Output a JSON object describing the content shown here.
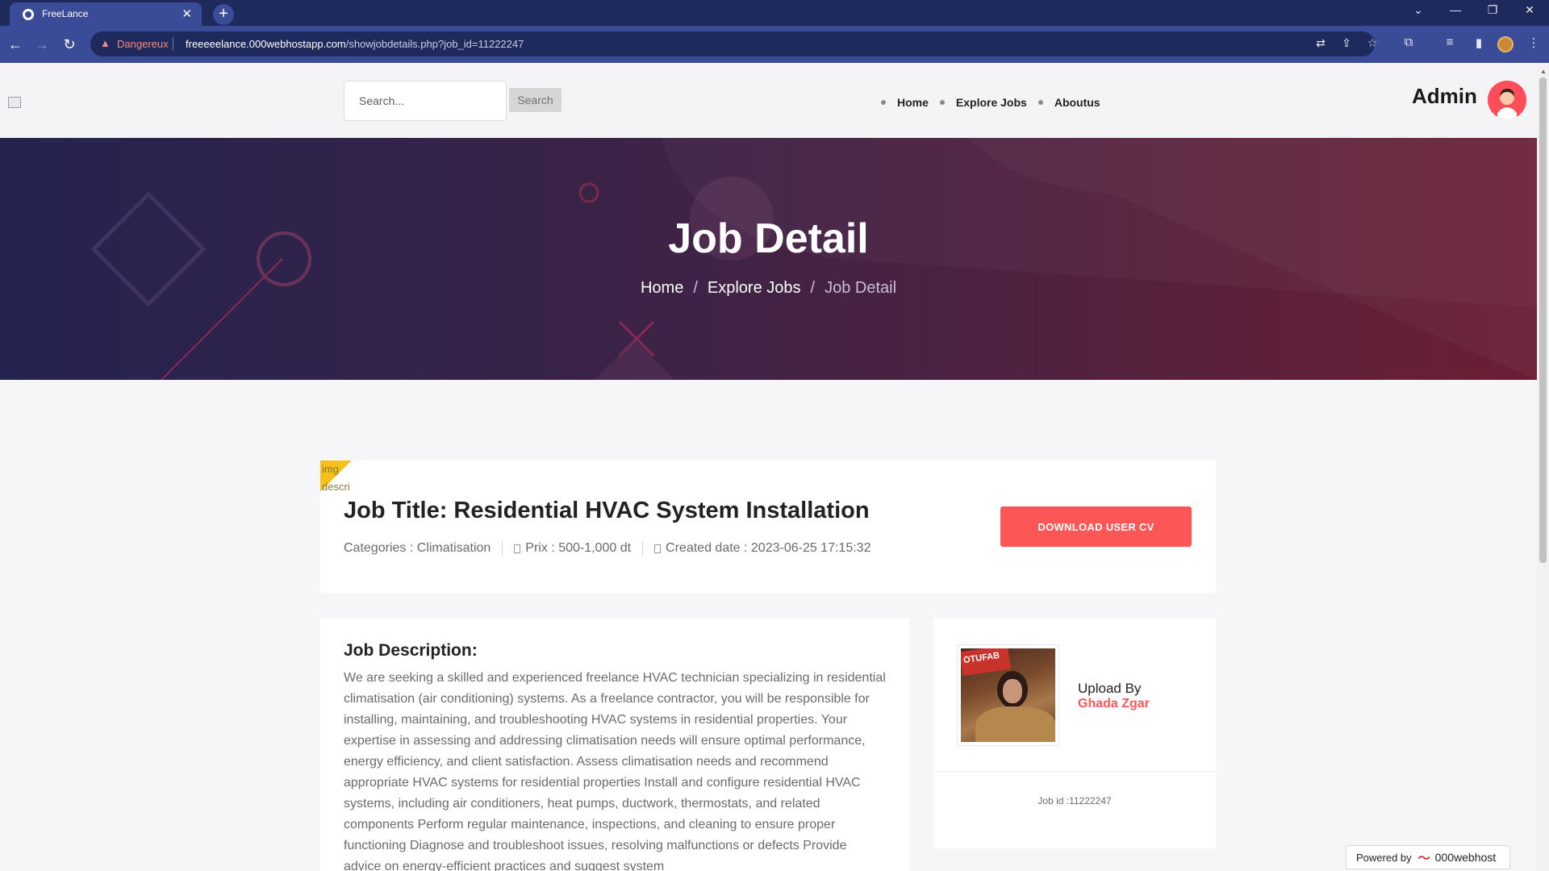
{
  "browser": {
    "tab_title": "FreeLance",
    "tab_close": "✕",
    "new_tab": "+",
    "security_label": "Dangereux",
    "url_host": "freeeeelance.000webhostapp.com",
    "url_path": "/showjobdetails.php?job_id=11222247"
  },
  "header": {
    "search_placeholder": "Search...",
    "search_button": "Search",
    "nav": [
      "Home",
      "Explore Jobs",
      "Aboutus"
    ],
    "admin_name": "Admin"
  },
  "hero": {
    "title": "Job Detail",
    "breadcrumb": [
      "Home",
      "Explore Jobs",
      "Job Detail"
    ],
    "separator": "/"
  },
  "job": {
    "ribbon_alt": "img descri",
    "title": "Job Title: Residential HVAC System Installation",
    "category": "Categories : Climatisation",
    "price": "Prix : 500-1,000 dt",
    "created": "Created date : 2023-06-25 17:15:32",
    "download_button": "DOWNLOAD USER CV"
  },
  "description": {
    "heading": "Job Description:",
    "body": "We are seeking a skilled and experienced freelance HVAC technician specializing in residential climatisation (air conditioning) systems. As a freelance contractor, you will be responsible for installing, maintaining, and troubleshooting HVAC systems in residential properties. Your expertise in assessing and addressing climatisation needs will ensure optimal performance, energy efficiency, and client satisfaction. Assess climatisation needs and recommend appropriate HVAC systems for residential properties Install and configure residential HVAC systems, including air conditioners, heat pumps, ductwork, thermostats, and related components Perform regular maintenance, inspections, and cleaning to ensure proper functioning Diagnose and troubleshoot issues, resolving malfunctions or defects Provide advice on energy-efficient practices and suggest system"
  },
  "uploader": {
    "photo_sign_text": "OTUFAB",
    "label": "Upload By",
    "name": "Ghada Zgar",
    "job_id": "Job id :11222247"
  },
  "footer_badge": {
    "prefix": "Powered by",
    "brand": "000webhost"
  },
  "colors": {
    "accent": "#fd5656",
    "browser_dark": "#1f2a5c",
    "browser_toolbar": "#3a4b97",
    "ribbon": "#f6c21a",
    "hero_left": "#24234f",
    "hero_right": "#6b1f35"
  }
}
